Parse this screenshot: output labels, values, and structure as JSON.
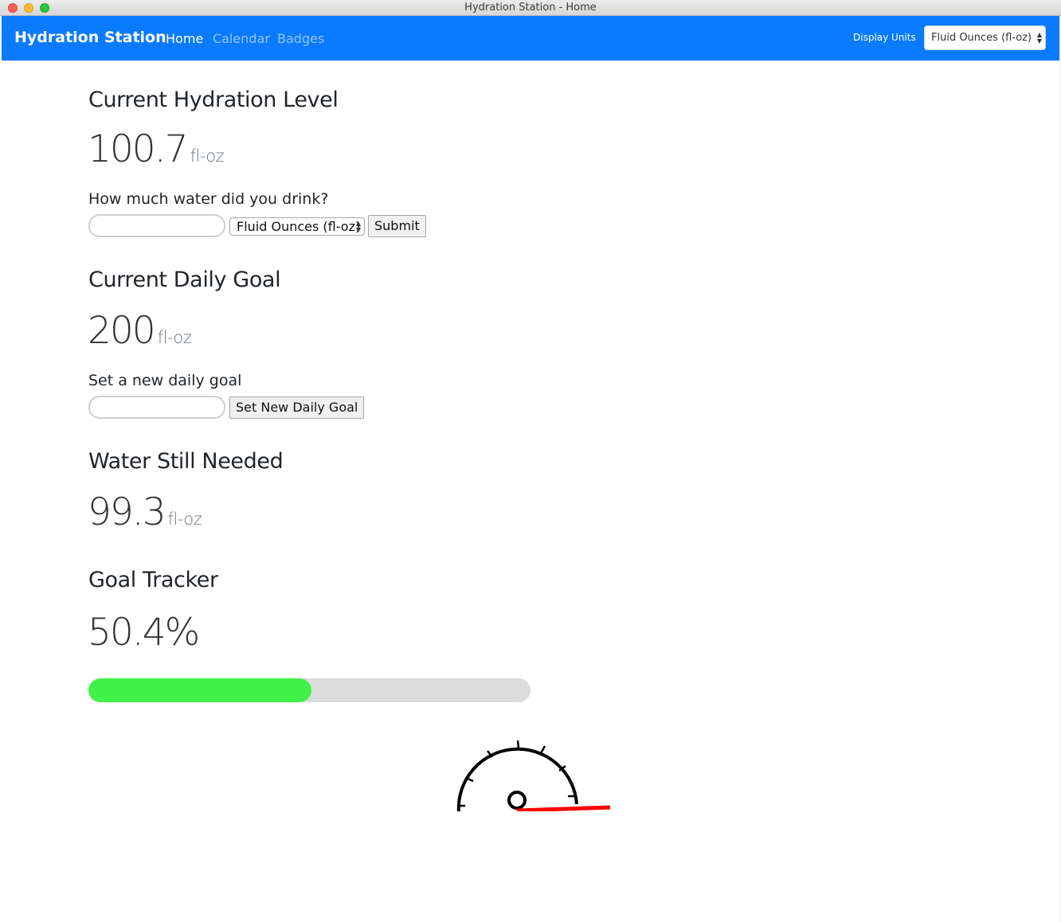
{
  "window": {
    "title": "Hydration Station - Home"
  },
  "navbar": {
    "brand": "Hydration Station",
    "links": [
      {
        "label": "Home",
        "active": true
      },
      {
        "label": "Calendar",
        "active": false
      },
      {
        "label": "Badges",
        "active": false
      }
    ],
    "display_units_label": "Display Units",
    "display_units_value": "Fluid Ounces (fl-oz)"
  },
  "hydration": {
    "heading": "Current Hydration Level",
    "value": "100.7",
    "unit": "fl-oz",
    "question": "How much water did you drink?",
    "input_value": "",
    "unit_select": "Fluid Ounces (fl-oz)",
    "submit_label": "Submit"
  },
  "goal": {
    "heading": "Current Daily Goal",
    "value": "200",
    "unit": "fl-oz",
    "set_label": "Set a new daily goal",
    "input_value": "",
    "button_label": "Set New Daily Goal"
  },
  "needed": {
    "heading": "Water Still Needed",
    "value": "99.3",
    "unit": "fl-oz"
  },
  "tracker": {
    "heading": "Goal Tracker",
    "percent_text": "50.4%",
    "progress_fraction": 0.504,
    "progress_color": "#42f04a"
  },
  "colors": {
    "navbar": "#0a7bff",
    "needle": "#ff0000"
  }
}
